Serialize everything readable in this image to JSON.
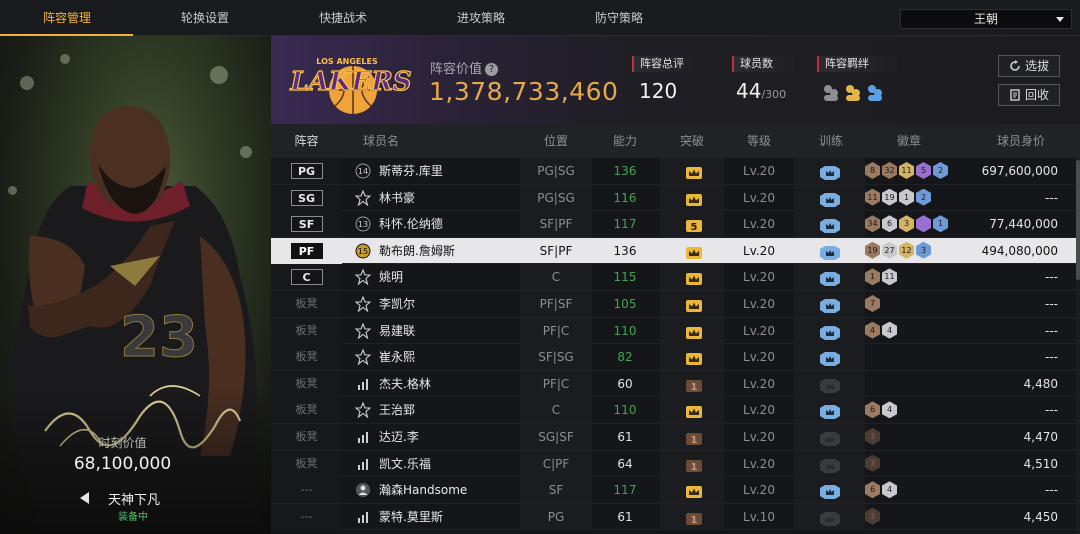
{
  "tabs": [
    {
      "label": "阵容管理",
      "active": true
    },
    {
      "label": "轮换设置",
      "active": false
    },
    {
      "label": "快捷战术",
      "active": false
    },
    {
      "label": "进攻策略",
      "active": false
    },
    {
      "label": "防守策略",
      "active": false
    }
  ],
  "team_select": {
    "value": "王朝"
  },
  "card": {
    "value_label": "时刻价值",
    "value": "68,100,000",
    "name": "天神下凡",
    "status": "装备中"
  },
  "team": {
    "logo_text": "LAKERS",
    "logo_top": "LOS ANGELES",
    "value_label": "阵容价值",
    "value": "1,378,733,460",
    "rating_label": "阵容总评",
    "rating": "120",
    "count_label": "球员数",
    "count": "44",
    "count_max": "/300",
    "chem_label": "阵容羁绊",
    "btn_scout": "选拔",
    "btn_recycle": "回收"
  },
  "columns": [
    "阵容",
    "球员名",
    "位置",
    "能力",
    "突破",
    "等级",
    "训练",
    "徽章",
    "球员身价"
  ],
  "colors": {
    "accent": "#f3b23a",
    "green": "#3fa84f",
    "gold_value": "#e7a84a"
  },
  "players": [
    {
      "slot": "PG",
      "boxed": true,
      "icon": "jersey-14-icon",
      "num": "14",
      "name": "斯蒂芬.库里",
      "pos": "PG|SG",
      "ability": "136",
      "ability_color": "green",
      "break": "crown",
      "level": "Lv.20",
      "train": "crown",
      "badges": [
        [
          "br",
          "8"
        ],
        [
          "br",
          "32"
        ],
        [
          "gd",
          "11"
        ],
        [
          "pu",
          "5"
        ],
        [
          "bl",
          "2"
        ]
      ],
      "value": "697,600,000",
      "selected": false
    },
    {
      "slot": "SG",
      "boxed": true,
      "icon": "star-icon",
      "num": "",
      "name": "林书豪",
      "pos": "PG|SG",
      "ability": "116",
      "ability_color": "green",
      "break": "crown",
      "level": "Lv.20",
      "train": "crown",
      "badges": [
        [
          "br",
          "11"
        ],
        [
          "sv",
          "19"
        ],
        [
          "sv",
          "1"
        ],
        [
          "bl",
          "2"
        ]
      ],
      "value": "---",
      "selected": false
    },
    {
      "slot": "SF",
      "boxed": true,
      "icon": "jersey-13-icon",
      "num": "13",
      "name": "科怀.伦纳德",
      "pos": "SF|PF",
      "ability": "117",
      "ability_color": "green",
      "break": "5",
      "level": "Lv.20",
      "train": "crown",
      "badges": [
        [
          "br",
          "34"
        ],
        [
          "sv",
          "6"
        ],
        [
          "gd",
          "3"
        ],
        [
          "pu",
          ""
        ],
        [
          "bl",
          "1"
        ]
      ],
      "value": "77,440,000",
      "selected": false
    },
    {
      "slot": "PF",
      "boxed": true,
      "icon": "jersey-15-icon",
      "num": "15",
      "name": "勒布朗.詹姆斯",
      "pos": "SF|PF",
      "ability": "136",
      "ability_color": "plain",
      "break": "crown",
      "level": "Lv.20",
      "train": "crown",
      "badges": [
        [
          "br",
          "19"
        ],
        [
          "sv",
          "27"
        ],
        [
          "gd",
          "12"
        ],
        [
          "bl",
          "3"
        ]
      ],
      "value": "494,080,000",
      "selected": true
    },
    {
      "slot": "C",
      "boxed": true,
      "icon": "star-icon",
      "num": "",
      "name": "姚明",
      "pos": "C",
      "ability": "115",
      "ability_color": "green",
      "break": "crown",
      "level": "Lv.20",
      "train": "crown",
      "badges": [
        [
          "br",
          "1"
        ],
        [
          "sv",
          "11"
        ]
      ],
      "value": "---",
      "selected": false
    },
    {
      "slot": "板凳",
      "boxed": false,
      "icon": "star-icon",
      "num": "",
      "name": "李凯尔",
      "pos": "PF|SF",
      "ability": "105",
      "ability_color": "green",
      "break": "crown",
      "level": "Lv.20",
      "train": "crown",
      "badges": [
        [
          "br",
          "7"
        ]
      ],
      "value": "---",
      "selected": false
    },
    {
      "slot": "板凳",
      "boxed": false,
      "icon": "star-icon",
      "num": "",
      "name": "易建联",
      "pos": "PF|C",
      "ability": "110",
      "ability_color": "green",
      "break": "crown",
      "level": "Lv.20",
      "train": "crown",
      "badges": [
        [
          "br",
          "4"
        ],
        [
          "sv",
          "4"
        ]
      ],
      "value": "---",
      "selected": false
    },
    {
      "slot": "板凳",
      "boxed": false,
      "icon": "star-icon",
      "num": "",
      "name": "崔永熙",
      "pos": "SF|SG",
      "ability": "82",
      "ability_color": "green",
      "break": "crown",
      "level": "Lv.20",
      "train": "crown",
      "badges": [],
      "value": "---",
      "selected": false
    },
    {
      "slot": "板凳",
      "boxed": false,
      "icon": "bars-icon",
      "num": "",
      "name": "杰夫.格林",
      "pos": "PF|C",
      "ability": "60",
      "ability_color": "plain",
      "break": "1",
      "level": "Lv.20",
      "train": "dim",
      "badges": [],
      "value": "4,480",
      "selected": false
    },
    {
      "slot": "板凳",
      "boxed": false,
      "icon": "star-icon",
      "num": "",
      "name": "王治郅",
      "pos": "C",
      "ability": "110",
      "ability_color": "green",
      "break": "crown",
      "level": "Lv.20",
      "train": "crown",
      "badges": [
        [
          "br",
          "6"
        ],
        [
          "sv",
          "4"
        ]
      ],
      "value": "---",
      "selected": false
    },
    {
      "slot": "板凳",
      "boxed": false,
      "icon": "bars-icon",
      "num": "",
      "name": "达迈.李",
      "pos": "SG|SF",
      "ability": "61",
      "ability_color": "plain",
      "break": "1",
      "level": "Lv.20",
      "train": "dim",
      "badges": [
        [
          "dk",
          "3"
        ]
      ],
      "value": "4,470",
      "selected": false
    },
    {
      "slot": "板凳",
      "boxed": false,
      "icon": "bars-icon",
      "num": "",
      "name": "凯文.乐福",
      "pos": "C|PF",
      "ability": "64",
      "ability_color": "plain",
      "break": "1",
      "level": "Lv.20",
      "train": "dim",
      "badges": [
        [
          "dk",
          "3"
        ]
      ],
      "value": "4,510",
      "selected": false
    },
    {
      "slot": "---",
      "boxed": false,
      "icon": "person-icon",
      "num": "",
      "name": "瀚森Handsome",
      "pos": "SF",
      "ability": "117",
      "ability_color": "green",
      "break": "crown",
      "level": "Lv.20",
      "train": "crown",
      "badges": [
        [
          "br",
          "6"
        ],
        [
          "sv",
          "4"
        ]
      ],
      "value": "---",
      "selected": false
    },
    {
      "slot": "---",
      "boxed": false,
      "icon": "bars-icon",
      "num": "",
      "name": "蒙特.莫里斯",
      "pos": "PG",
      "ability": "61",
      "ability_color": "plain",
      "break": "1",
      "level": "Lv.10",
      "train": "dim",
      "badges": [
        [
          "dk",
          "3"
        ]
      ],
      "value": "4,450",
      "selected": false
    }
  ]
}
